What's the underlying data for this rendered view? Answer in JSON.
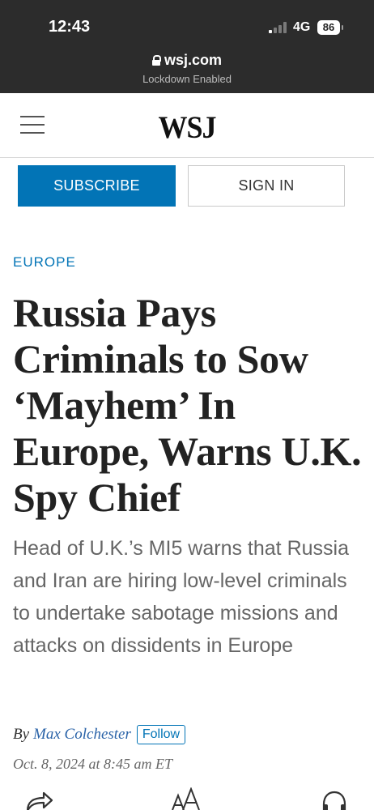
{
  "status_bar": {
    "time": "12:43",
    "network": "4G",
    "battery": "86"
  },
  "browser": {
    "url": "wsj.com",
    "mode": "Lockdown Enabled"
  },
  "header": {
    "logo": "WSJ",
    "menu_icon": "hamburger-menu-icon"
  },
  "account": {
    "subscribe_label": "SUBSCRIBE",
    "signin_label": "SIGN IN"
  },
  "article": {
    "section": "EUROPE",
    "headline": "Russia Pays Criminals to Sow ‘Mayhem’ In Europe, Warns U.K. Spy Chief",
    "dek": "Head of U.K.’s MI5 warns that Russia and Iran are hiring low-level criminals to undertake sabotage missions and attacks on dissidents in Europe",
    "by_prefix": "By",
    "author": "Max Colchester",
    "follow_label": "Follow",
    "date": "Oct. 8, 2024 at 8:45 am ET"
  },
  "toolbar": {
    "icons": [
      "share-icon",
      "text-size-icon",
      "listen-icon"
    ]
  },
  "colors": {
    "accent": "#0274b6",
    "topbar": "#2c2c2c"
  }
}
